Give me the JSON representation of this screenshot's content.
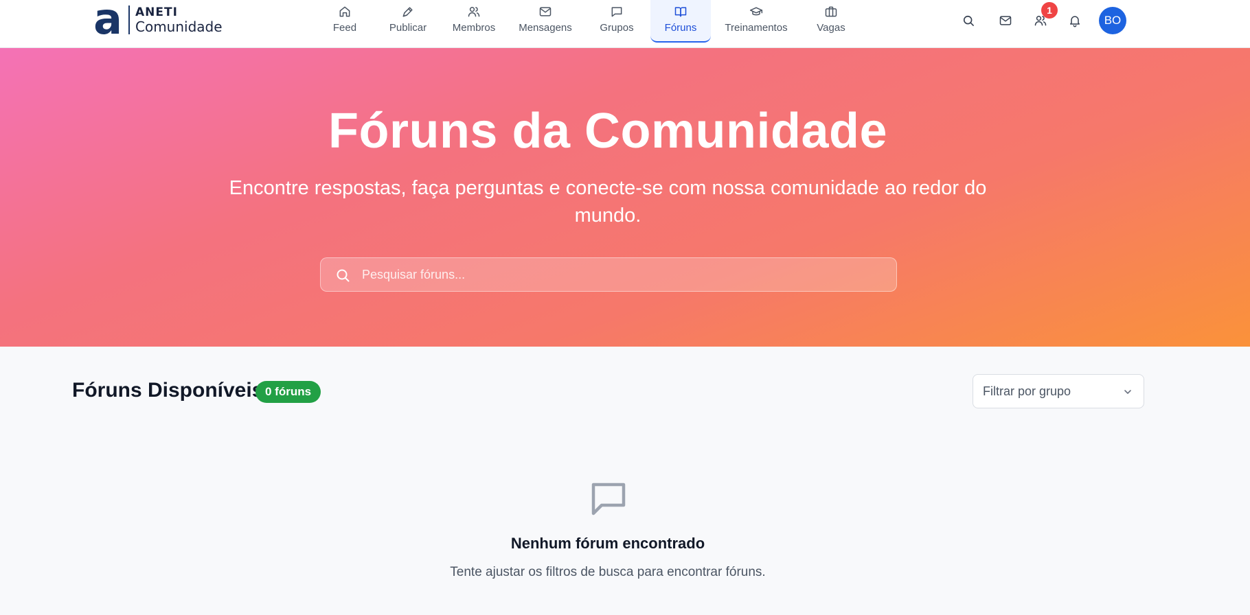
{
  "brand": {
    "logo_letter": "a",
    "name": "ANETI",
    "subtitle": "Comunidade",
    "color": "#1a3566"
  },
  "nav": {
    "items": [
      {
        "label": "Feed",
        "icon": "home-icon"
      },
      {
        "label": "Publicar",
        "icon": "pen-icon"
      },
      {
        "label": "Membros",
        "icon": "users-icon"
      },
      {
        "label": "Mensagens",
        "icon": "mail-icon"
      },
      {
        "label": "Grupos",
        "icon": "chat-icon"
      },
      {
        "label": "Fóruns",
        "icon": "book-icon",
        "active": true
      },
      {
        "label": "Treinamentos",
        "icon": "graduation-cap-icon"
      },
      {
        "label": "Vagas",
        "icon": "briefcase-icon"
      }
    ],
    "active_color": "#1d4ed8"
  },
  "actions": {
    "icons": [
      "search-icon",
      "mail-icon",
      "users-icon",
      "bell-icon"
    ],
    "friend_requests_badge": "1",
    "avatar_initials": "BO",
    "badge_color": "#ef4444",
    "avatar_color": "#1d63e0"
  },
  "hero": {
    "title": "Fóruns da Comunidade",
    "subtitle": "Encontre respostas, faça perguntas e conecte-se com nossa comunidade ao redor do mundo.",
    "search_placeholder": "Pesquisar fóruns...",
    "search_value": "",
    "gradient": [
      "#f472b6",
      "#f4727f",
      "#f6786a",
      "#fa923a"
    ]
  },
  "forums": {
    "section_title": "Fóruns Disponíveis",
    "count_label": "0 fóruns",
    "count_color": "#22a045",
    "filter_label": "Filtrar por grupo",
    "empty_title": "Nenhum fórum encontrado",
    "empty_text": "Tente ajustar os filtros de busca para encontrar fóruns."
  }
}
